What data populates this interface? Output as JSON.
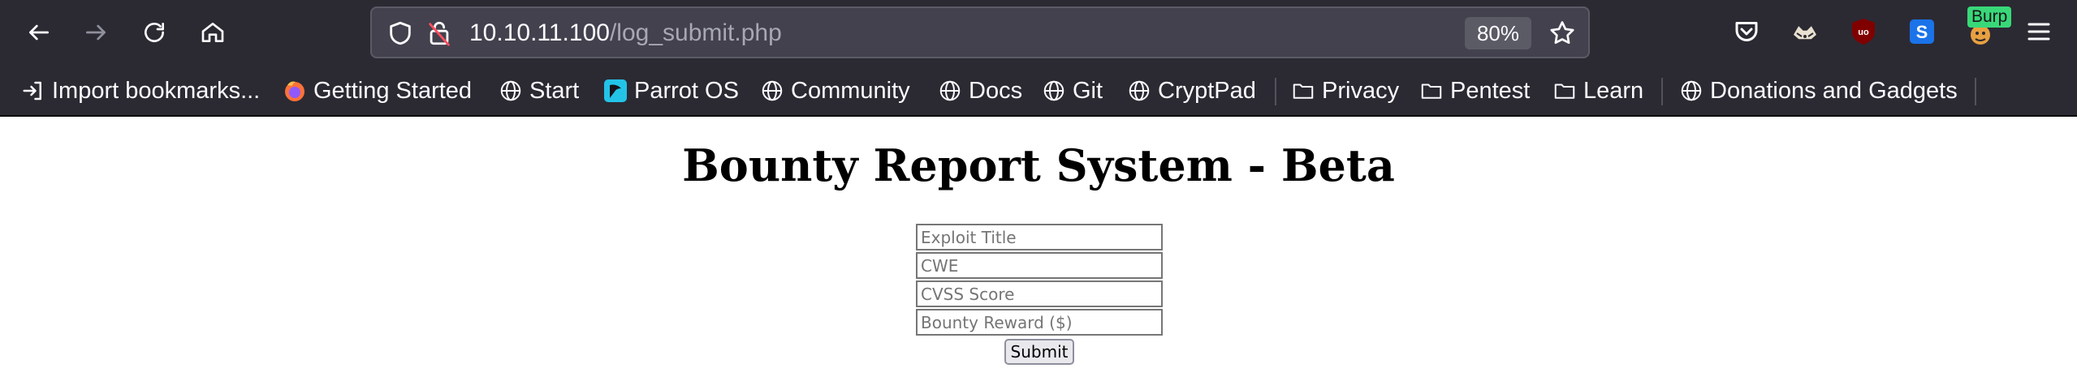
{
  "browser": {
    "url_host": "10.10.11.100",
    "url_path": "/log_submit.php",
    "zoom": "80%",
    "burp_badge": "Burp",
    "nav_icons": [
      "back-arrow-icon",
      "forward-arrow-icon",
      "reload-icon",
      "home-icon"
    ],
    "extension_icons": [
      "pocket-icon",
      "foxyproxy-icon",
      "ublock-origin-icon",
      "sider-extension-icon",
      "burp-proxy-icon",
      "menu-hamburger-icon"
    ]
  },
  "bookmarks": [
    {
      "label": "Import bookmarks...",
      "icon": "import-icon"
    },
    {
      "label": "Getting Started",
      "icon": "firefox-icon"
    },
    {
      "label": "Start",
      "icon": "globe-icon"
    },
    {
      "label": "Parrot OS",
      "icon": "parrot-icon"
    },
    {
      "label": "Community",
      "icon": "globe-icon"
    },
    {
      "label": "Docs",
      "icon": "globe-icon"
    },
    {
      "label": "Git",
      "icon": "globe-icon"
    },
    {
      "label": "CryptPad",
      "icon": "globe-icon"
    },
    {
      "label": "Privacy",
      "icon": "folder-icon"
    },
    {
      "label": "Pentest",
      "icon": "folder-icon"
    },
    {
      "label": "Learn",
      "icon": "folder-icon"
    },
    {
      "label": "Donations and Gadgets",
      "icon": "globe-icon"
    }
  ],
  "page": {
    "title": "Bounty Report System - Beta",
    "form": {
      "exploit_title_placeholder": "Exploit Title",
      "cwe_placeholder": "CWE",
      "cvss_placeholder": "CVSS Score",
      "reward_placeholder": "Bounty Reward ($)",
      "submit_label": "Submit"
    }
  },
  "colors": {
    "chrome_bg": "#2b2a33",
    "urlbar_bg": "#42414d",
    "ublock_red": "#800000",
    "sider_blue": "#1a73e8",
    "burp_badge_green": "#38d878"
  }
}
